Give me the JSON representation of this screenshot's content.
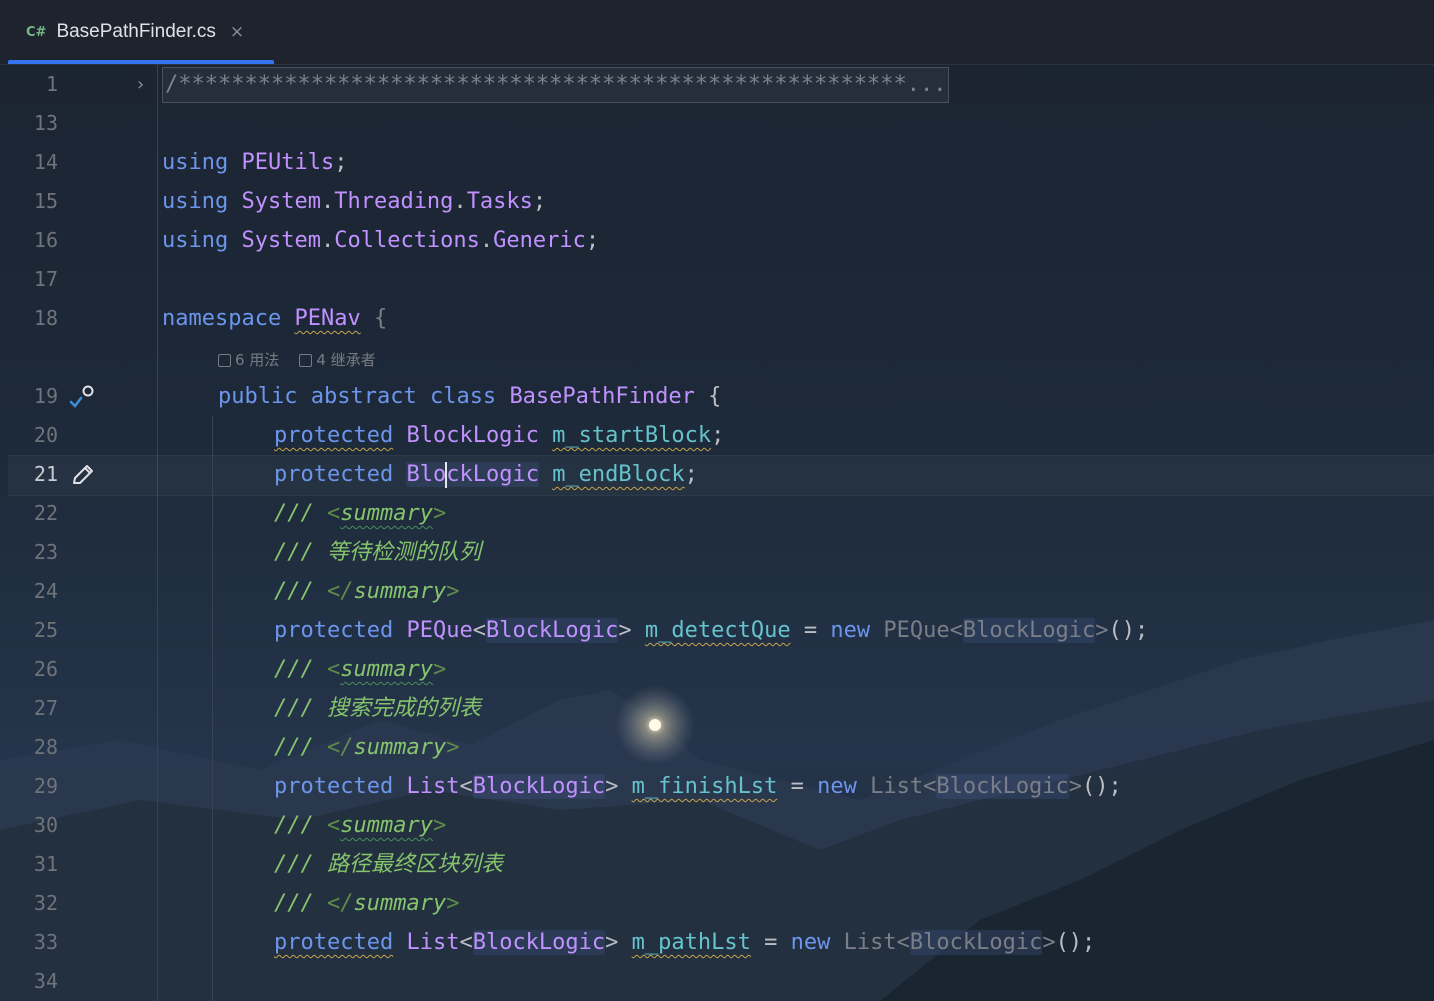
{
  "tab": {
    "lang": "C#",
    "filename": "BasePathFinder.cs",
    "close": "×"
  },
  "inlay_hints": {
    "usages": "6 用法",
    "inheritors": "4 继承者"
  },
  "lines": [
    {
      "n": "1"
    },
    {
      "n": "13"
    },
    {
      "n": "14"
    },
    {
      "n": "15"
    },
    {
      "n": "16"
    },
    {
      "n": "17"
    },
    {
      "n": "18"
    },
    {
      "n": "19"
    },
    {
      "n": "20"
    },
    {
      "n": "21"
    },
    {
      "n": "22"
    },
    {
      "n": "23"
    },
    {
      "n": "24"
    },
    {
      "n": "25"
    },
    {
      "n": "26"
    },
    {
      "n": "27"
    },
    {
      "n": "28"
    },
    {
      "n": "29"
    },
    {
      "n": "30"
    },
    {
      "n": "31"
    },
    {
      "n": "32"
    },
    {
      "n": "33"
    },
    {
      "n": "34"
    }
  ],
  "code": {
    "fold_comment": "/*******************************************************...",
    "kw_using": "using",
    "kw_namespace": "namespace",
    "kw_public": "public",
    "kw_abstract": "abstract",
    "kw_class": "class",
    "kw_protected": "protected",
    "kw_new": "new",
    "ns_peutils": "PEUtils",
    "ns_system": "System",
    "ns_threading": "Threading",
    "ns_tasks": "Tasks",
    "ns_collections": "Collections",
    "ns_generic": "Generic",
    "ns_penav": "PENav",
    "class_name": "BasePathFinder",
    "type_blocklogic": "BlockLogic",
    "type_blocklogic_a": "Blo",
    "type_blocklogic_b": "ckLogic",
    "type_peque": "PEQue",
    "type_list": "List",
    "field_start": "m_startBlock",
    "field_end": "m_endBlock",
    "field_detect": "m_detectQue",
    "field_finish": "m_finishLst",
    "field_path": "m_pathLst",
    "doc_slashes": "///",
    "doc_summary": "summary",
    "doc_detect": "等待检测的队列",
    "doc_finish": "搜索完成的列表",
    "doc_path": "路径最终区块列表"
  },
  "colors": {
    "keyword": "#6c95eb",
    "type": "#c191ff",
    "field": "#66c3cc",
    "comment": "#85c46c",
    "tab_accent": "#3574f0"
  },
  "icons": {
    "tab_close": "close-icon",
    "fold": "chevron-right-icon",
    "implemented": "override-marker-icon",
    "edit": "pencil-icon"
  }
}
